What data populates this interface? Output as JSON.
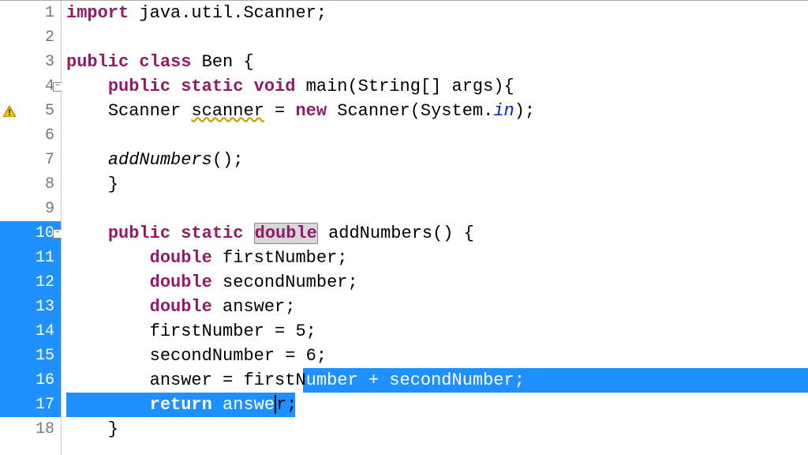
{
  "lineNumbers": [
    "1",
    "2",
    "3",
    "4",
    "5",
    "6",
    "7",
    "8",
    "9",
    "10",
    "11",
    "12",
    "13",
    "14",
    "15",
    "16",
    "17",
    "18"
  ],
  "gutter": {
    "foldLines": [
      4,
      10
    ],
    "warnLine": 5,
    "selectedRange": [
      10,
      17
    ]
  },
  "code": {
    "l1": {
      "import": "import",
      "rest": " java.util.Scanner;"
    },
    "l3": {
      "public": "public",
      "class": "class",
      "name": " Ben {"
    },
    "l4": {
      "indent": "    ",
      "public": "public",
      "static": "static",
      "void": "void",
      "sig": " main(String[] args){"
    },
    "l5": {
      "indent": "    ",
      "type": "Scanner ",
      "var": "scanner",
      "eq": " = ",
      "new": "new",
      "ctor": " Scanner(System.",
      "in": "in",
      "end": ");"
    },
    "l7": {
      "indent": "    ",
      "call": "addNumbers",
      "rest": "();"
    },
    "l8": {
      "indent": "    ",
      "brace": "}"
    },
    "l10": {
      "indent": "    ",
      "public": "public",
      "static": "static",
      "double": "double",
      "sig": " addNumbers() {"
    },
    "l11": {
      "indent": "        ",
      "double": "double",
      "rest": " firstNumber;"
    },
    "l12": {
      "indent": "        ",
      "double": "double",
      "rest": " secondNumber;"
    },
    "l13": {
      "indent": "        ",
      "double": "double",
      "rest": " answer;"
    },
    "l14": {
      "indent": "        ",
      "text": "firstNumber = 5;"
    },
    "l15": {
      "indent": "        ",
      "text": "secondNumber = 6;"
    },
    "l16": {
      "indent": "        ",
      "pre": "answer = firstN",
      "sel": "umber + secondNumber;"
    },
    "l17": {
      "indent": "        ",
      "return": "return",
      "preSel": " answe",
      "postCursor": "r;"
    },
    "l18": {
      "indent": "    ",
      "brace": "}"
    }
  }
}
